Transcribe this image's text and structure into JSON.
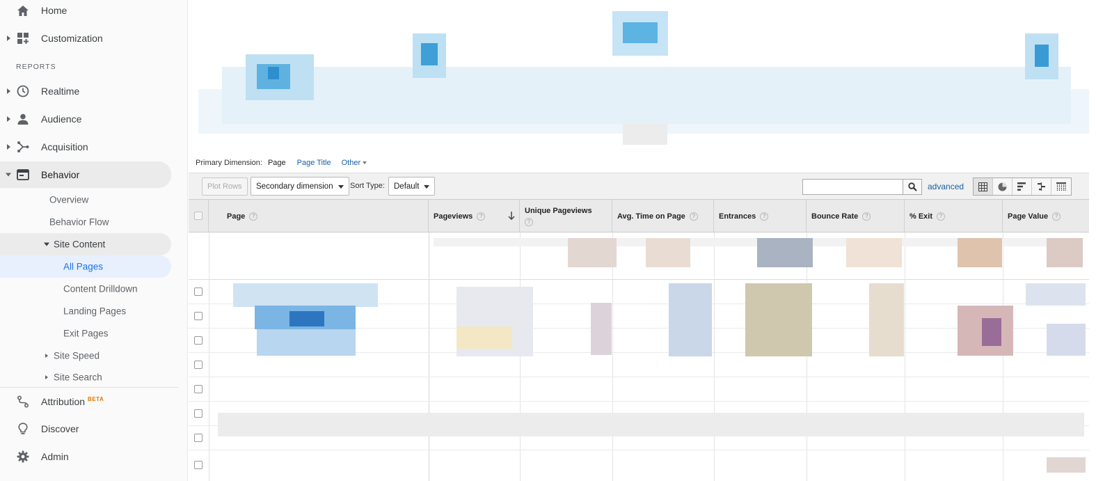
{
  "sidebar": {
    "top_items": [
      {
        "label": "Home",
        "icon": "home-icon"
      },
      {
        "label": "Customization",
        "icon": "customization-icon"
      }
    ],
    "section_label": "REPORTS",
    "report_items": [
      {
        "label": "Realtime",
        "icon": "clock-icon"
      },
      {
        "label": "Audience",
        "icon": "person-icon"
      },
      {
        "label": "Acquisition",
        "icon": "acquisition-icon"
      },
      {
        "label": "Behavior",
        "icon": "behavior-icon"
      }
    ],
    "behavior_children": [
      {
        "label": "Overview"
      },
      {
        "label": "Behavior Flow"
      },
      {
        "label": "Site Content"
      },
      {
        "label": "All Pages"
      },
      {
        "label": "Content Drilldown"
      },
      {
        "label": "Landing Pages"
      },
      {
        "label": "Exit Pages"
      },
      {
        "label": "Site Speed"
      },
      {
        "label": "Site Search"
      }
    ],
    "bottom_items": [
      {
        "label": "Attribution",
        "badge": "BETA",
        "icon": "attribution-icon"
      },
      {
        "label": "Discover",
        "icon": "lightbulb-icon"
      },
      {
        "label": "Admin",
        "icon": "gear-icon"
      }
    ]
  },
  "dimension_bar": {
    "label": "Primary Dimension:",
    "current": "Page",
    "links": [
      "Page Title",
      "Other"
    ]
  },
  "toolbar": {
    "plot_rows": "Plot Rows",
    "secondary_dimension": "Secondary dimension",
    "sort_type_label": "Sort Type:",
    "sort_type_value": "Default",
    "search_value": "",
    "advanced": "advanced"
  },
  "table": {
    "columns": [
      {
        "label": "Page"
      },
      {
        "label": "Pageviews"
      },
      {
        "label": "Unique Pageviews"
      },
      {
        "label": "Avg. Time on Page"
      },
      {
        "label": "Entrances"
      },
      {
        "label": "Bounce Rate"
      },
      {
        "label": "% Exit"
      },
      {
        "label": "Page Value"
      }
    ],
    "help_glyph": "?"
  },
  "colors": {
    "accent_blue": "#1a73e8",
    "link_blue": "#1a5fa4",
    "selected_bg": "#e8f0fe",
    "sidebar_bg": "#fafafa",
    "header_bg": "#eaeaea"
  }
}
